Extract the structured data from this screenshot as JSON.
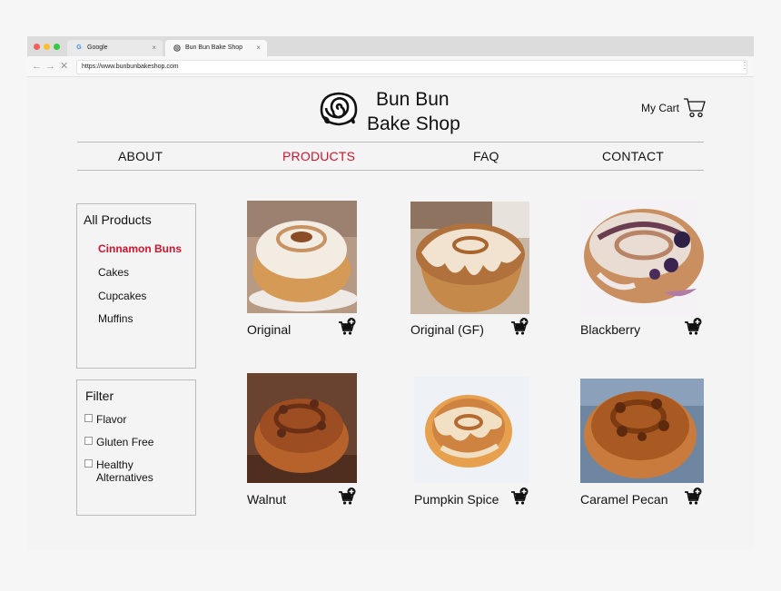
{
  "browser": {
    "tabs": [
      {
        "label": "Google",
        "icon": "google-icon"
      },
      {
        "label": "Bun Bun Bake Shop",
        "icon": "site-favicon-icon"
      }
    ],
    "tab_close": "×",
    "url": "https://www.bunbunbakeshop.com",
    "nav_icons": {
      "back": "←",
      "forward": "→",
      "stop": "✕",
      "menu": "⋮"
    }
  },
  "site": {
    "brand_line1": "Bun Bun",
    "brand_line2": "Bake Shop",
    "cart_label": "My Cart"
  },
  "nav": [
    {
      "label": "ABOUT"
    },
    {
      "label": "PRODUCTS",
      "active": true
    },
    {
      "label": "FAQ"
    },
    {
      "label": "CONTACT"
    }
  ],
  "sidebar": {
    "products_title": "All Products",
    "categories": [
      {
        "label": "Cinnamon Buns",
        "active": true
      },
      {
        "label": "Cakes"
      },
      {
        "label": "Cupcakes"
      },
      {
        "label": "Muffins"
      }
    ],
    "filter_title": "Filter",
    "filters": [
      {
        "label": "Flavor",
        "checked": false
      },
      {
        "label": "Gluten Free",
        "checked": false
      },
      {
        "label": "Healthy",
        "label2": "Alternatives",
        "checked": false
      }
    ]
  },
  "products": [
    {
      "name": "Original"
    },
    {
      "name": "Original (GF)"
    },
    {
      "name": "Blackberry"
    },
    {
      "name": "Walnut"
    },
    {
      "name": "Pumpkin Spice"
    },
    {
      "name": "Caramel Pecan"
    }
  ],
  "colors": {
    "accent": "#d0142c",
    "text": "#111111",
    "border": "#bbbbbb"
  }
}
